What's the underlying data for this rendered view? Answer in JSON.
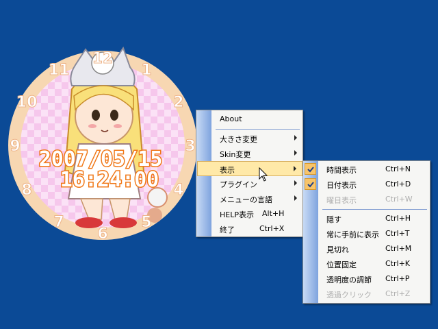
{
  "clock": {
    "date": "2007/05/15",
    "time": "16:24:00",
    "numerals": [
      "12",
      "1",
      "2",
      "3",
      "4",
      "5",
      "6",
      "7",
      "8",
      "9",
      "10",
      "11"
    ]
  },
  "main_menu": {
    "items": [
      {
        "label": "About"
      },
      {
        "label": "大きさ変更"
      },
      {
        "label": "Skin変更"
      },
      {
        "label": "表示"
      },
      {
        "label": "プラグイン"
      },
      {
        "label": "メニューの言語"
      },
      {
        "label": "HELP表示",
        "shortcut": "Alt+H"
      },
      {
        "label": "終了",
        "shortcut": "Ctrl+X"
      }
    ]
  },
  "sub_menu": {
    "items": [
      {
        "label": "時間表示",
        "shortcut": "Ctrl+N",
        "checked": true
      },
      {
        "label": "日付表示",
        "shortcut": "Ctrl+D",
        "checked": true
      },
      {
        "label": "曜日表示",
        "shortcut": "Ctrl+W",
        "disabled": true
      },
      {
        "label": "隠す",
        "shortcut": "Ctrl+H"
      },
      {
        "label": "常に手前に表示",
        "shortcut": "Ctrl+T"
      },
      {
        "label": "見切れ",
        "shortcut": "Ctrl+M"
      },
      {
        "label": "位置固定",
        "shortcut": "Ctrl+K"
      },
      {
        "label": "透明度の調節",
        "shortcut": "Ctrl+P"
      },
      {
        "label": "透過クリック",
        "shortcut": "Ctrl+Z",
        "disabled": true
      }
    ]
  },
  "colors": {
    "desktop": "#0b4a96",
    "highlight": "#ffe9a8",
    "accent": "#f07818"
  }
}
